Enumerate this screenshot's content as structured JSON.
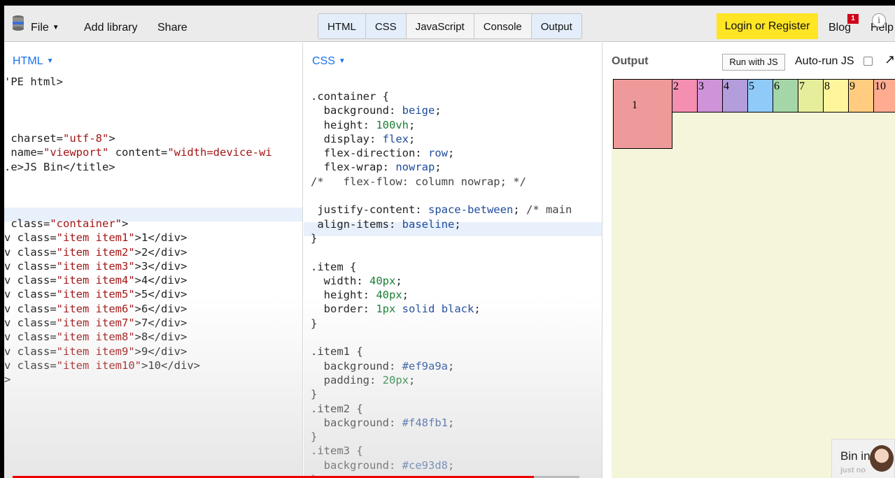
{
  "topbar": {
    "file": "File",
    "add_library": "Add library",
    "share": "Share",
    "tabs": [
      "HTML",
      "CSS",
      "JavaScript",
      "Console",
      "Output"
    ],
    "login": "Login or Register",
    "blog": "Blog",
    "blog_badge": "1",
    "help": "Help",
    "info": "i"
  },
  "html_panel": {
    "title": "HTML"
  },
  "css_panel": {
    "title": "CSS"
  },
  "output_panel": {
    "title": "Output",
    "run_button": "Run with JS",
    "autorun_label": "Auto-run JS",
    "items": [
      "1",
      "2",
      "3",
      "4",
      "5",
      "6",
      "7",
      "8",
      "9",
      "10"
    ],
    "item_colors": [
      "#ef9a9a",
      "#f48fb1",
      "#ce93d8",
      "#b39ddb",
      "#90caf9",
      "#a5d6a7",
      "#e6ee9c",
      "#fff59d",
      "#ffcc80",
      "#ffab91"
    ],
    "popup_text": "Bin in",
    "popup_sub": "just no"
  },
  "video": {
    "progress": 0.92
  }
}
